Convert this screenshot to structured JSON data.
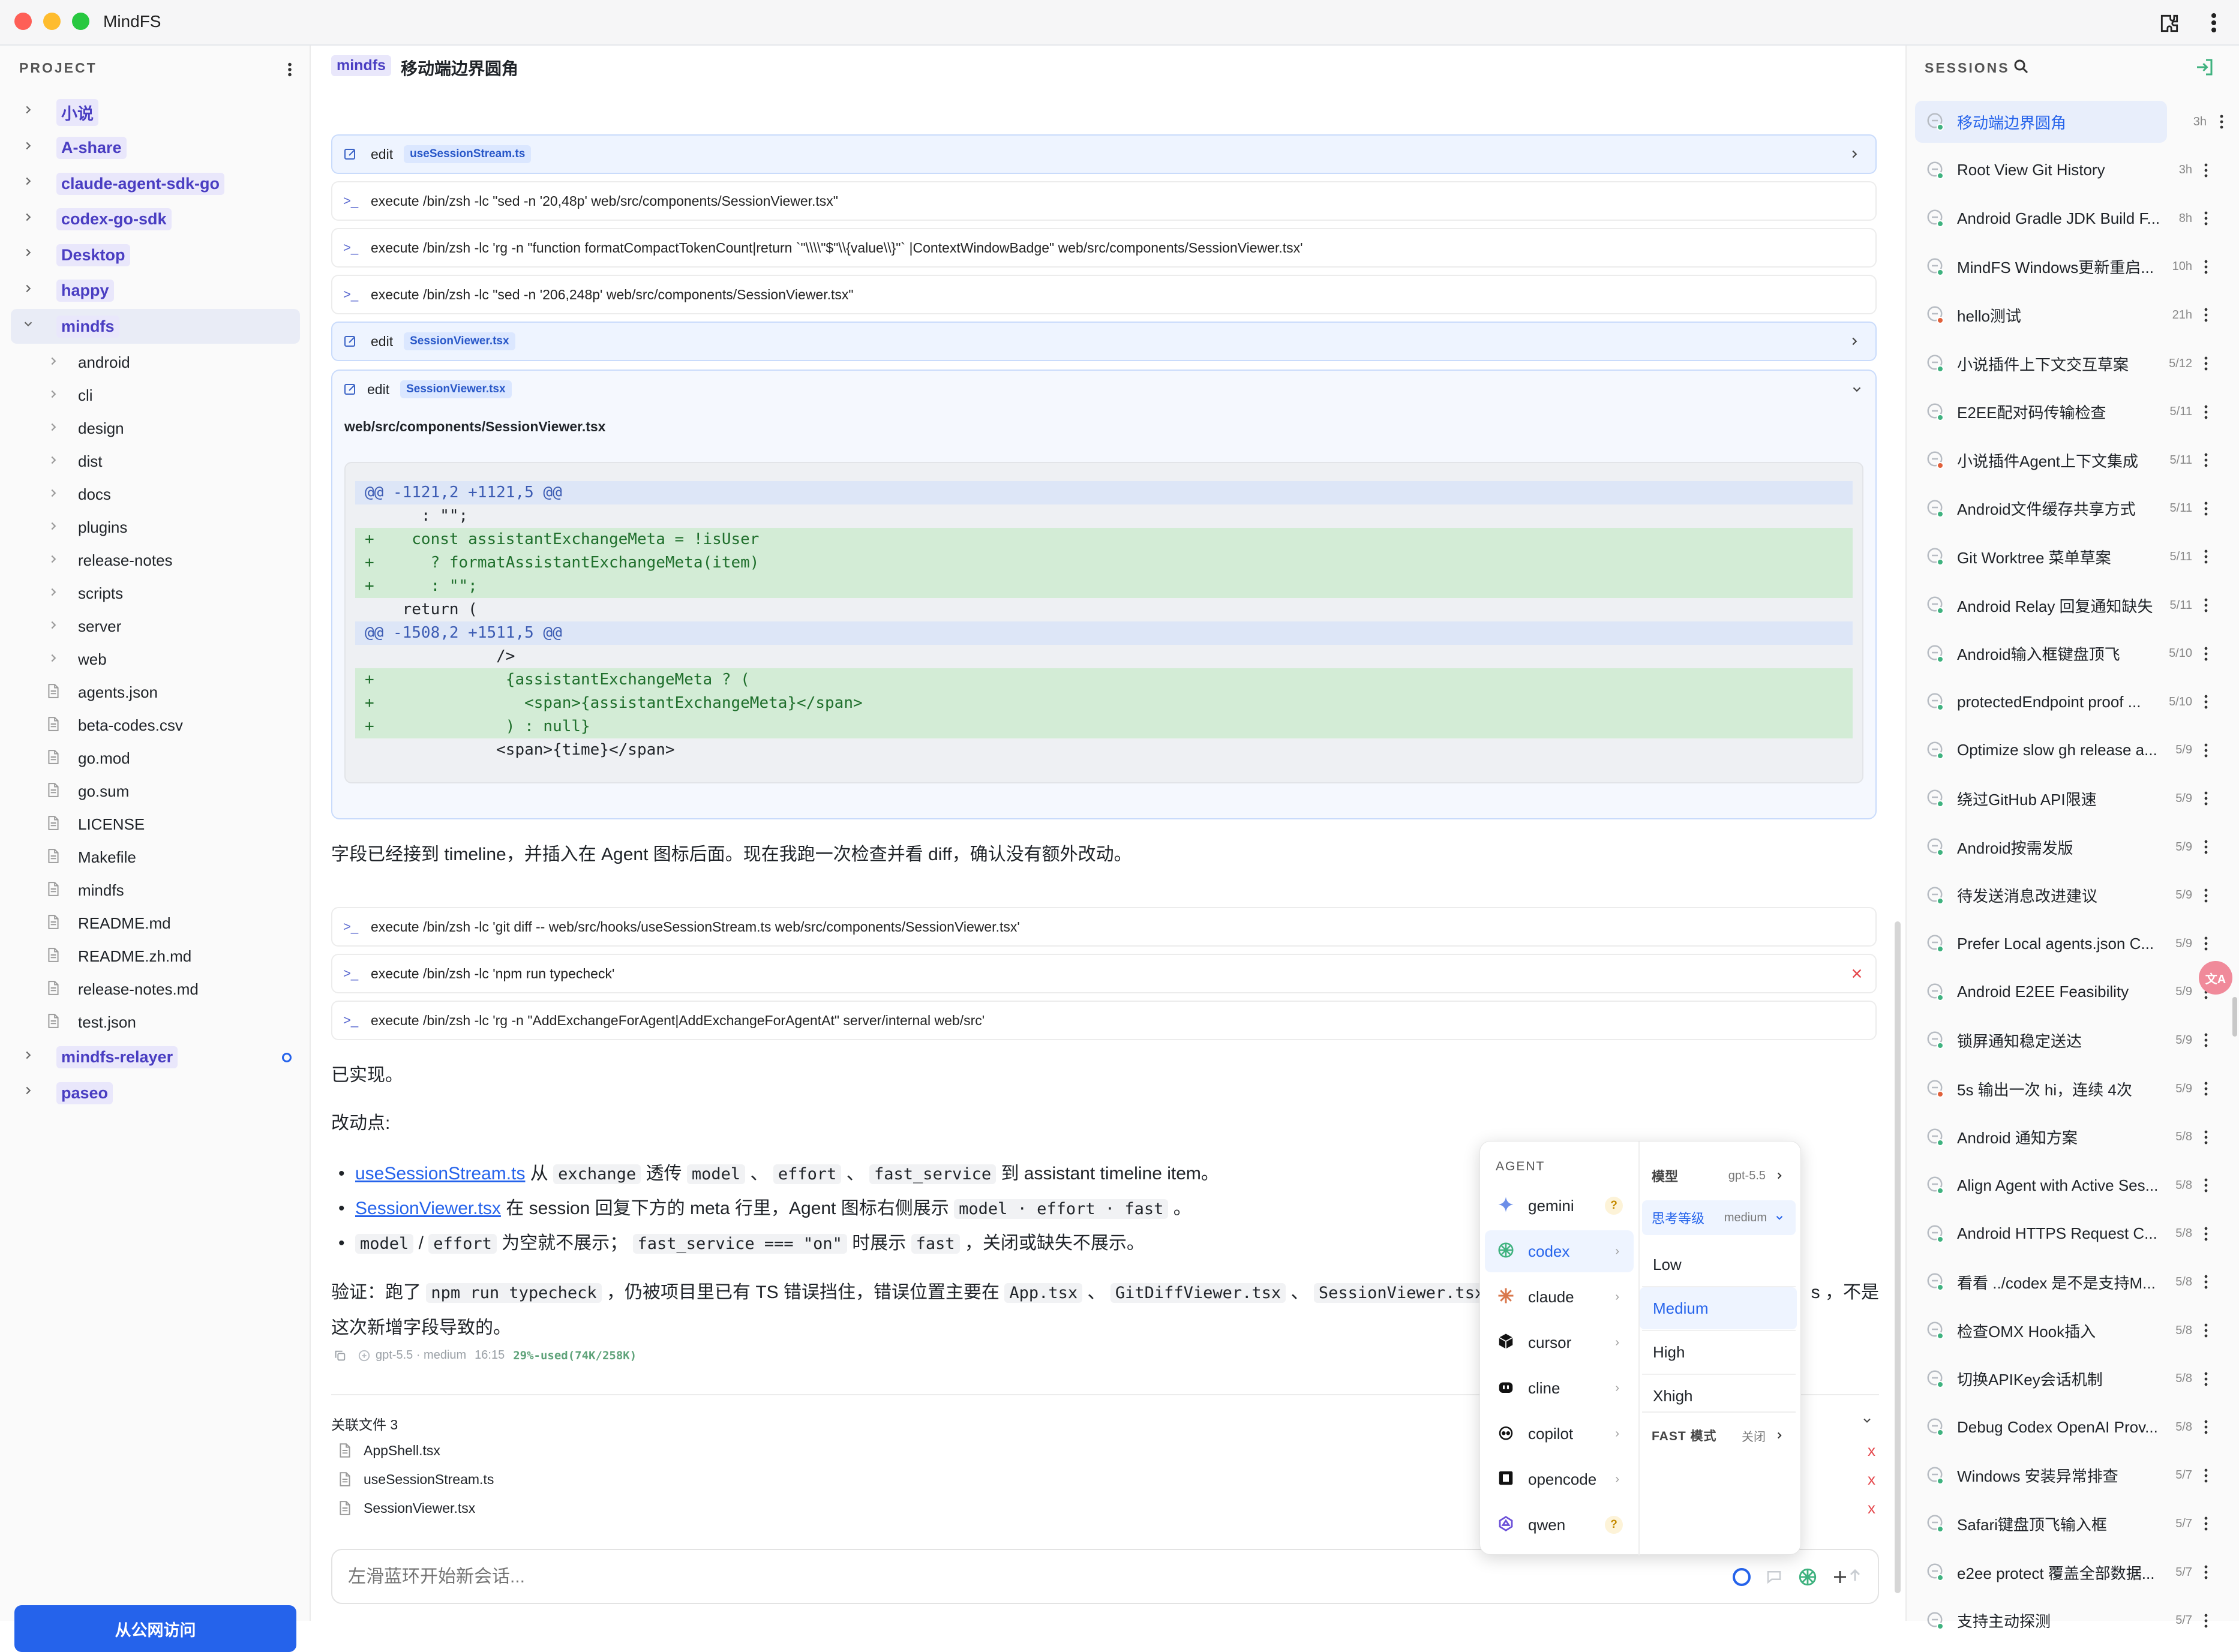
{
  "app": {
    "title": "MindFS"
  },
  "left": {
    "header": "PROJECT",
    "projects_top": [
      "小说",
      "A-share",
      "claude-agent-sdk-go",
      "codex-go-sdk",
      "Desktop",
      "happy"
    ],
    "active_project": "mindfs",
    "folders": [
      "android",
      "cli",
      "design",
      "dist",
      "docs",
      "plugins",
      "release-notes",
      "scripts",
      "server",
      "web"
    ],
    "files": [
      "agents.json",
      "beta-codes.csv",
      "go.mod",
      "go.sum",
      "LICENSE",
      "Makefile",
      "mindfs",
      "README.md",
      "README.zh.md",
      "release-notes.md",
      "test.json"
    ],
    "projects_bottom": [
      "mindfs-relayer",
      "paseo"
    ],
    "public_button": "从公网访问"
  },
  "center": {
    "header_tag": "mindfs",
    "header_title": "移动端边界圆角",
    "cmds": [
      {
        "kind": "edit",
        "label": "edit",
        "chip": "useSessionStream.ts"
      },
      {
        "kind": "exec",
        "label": "execute /bin/zsh -lc \"sed -n '20,48p' web/src/components/SessionViewer.tsx\""
      },
      {
        "kind": "exec",
        "label": "execute /bin/zsh -lc 'rg -n \"function formatCompactTokenCount|return `\"\\\\\\\\\"$\"\\\\{value\\\\}\"` |ContextWindowBadge\" web/src/components/SessionViewer.tsx'"
      },
      {
        "kind": "exec",
        "label": "execute /bin/zsh -lc \"sed -n '206,248p' web/src/components/SessionViewer.tsx\""
      },
      {
        "kind": "edit",
        "label": "edit",
        "chip": "SessionViewer.tsx"
      }
    ],
    "expanded_edit": {
      "label": "edit",
      "chip": "SessionViewer.tsx",
      "path": "web/src/components/SessionViewer.tsx"
    },
    "diff": [
      {
        "t": "hunk",
        "text": "@@ -1121,2 +1121,5 @@"
      },
      {
        "t": "ctx",
        "text": "      : \"\";"
      },
      {
        "t": "add",
        "text": "+    const assistantExchangeMeta = !isUser"
      },
      {
        "t": "add",
        "text": "+      ? formatAssistantExchangeMeta(item)"
      },
      {
        "t": "add",
        "text": "+      : \"\";"
      },
      {
        "t": "ctx",
        "text": "    return ("
      },
      {
        "t": "hunk",
        "text": "@@ -1508,2 +1511,5 @@"
      },
      {
        "t": "ctx",
        "text": "              />"
      },
      {
        "t": "add",
        "text": "+              {assistantExchangeMeta ? ("
      },
      {
        "t": "add",
        "text": "+                <span>{assistantExchangeMeta}</span>"
      },
      {
        "t": "add",
        "text": "+              ) : null}"
      },
      {
        "t": "ctx",
        "text": "              <span>{time}</span>"
      }
    ],
    "note1": "字段已经接到 timeline，并插入在 Agent 图标后面。现在我跑一次检查并看 diff，确认没有额外改动。",
    "cmds2": [
      {
        "label": "execute /bin/zsh -lc 'git diff -- web/src/hooks/useSessionStream.ts web/src/components/SessionViewer.tsx'",
        "error": false
      },
      {
        "label": "execute /bin/zsh -lc 'npm run typecheck'",
        "error": true
      },
      {
        "label": "execute /bin/zsh -lc 'rg -n \"AddExchangeForAgent|AddExchangeForAgentAt\" server/internal web/src'",
        "error": false
      }
    ],
    "done": "已实现。",
    "changes_title": "改动点:",
    "b1": {
      "link": "useSessionStream.ts",
      "t1": " 从 ",
      "c1": "exchange",
      "t2": " 透传 ",
      "c2": "model",
      "c3": "effort",
      "c4": "fast_service",
      "t3": " 到 assistant timeline item。",
      "sep": " 、 "
    },
    "b2": {
      "link": "SessionViewer.tsx",
      "t1": " 在 session 回复下方的 meta 行里，Agent 图标右侧展示 ",
      "c1": "model · effort · fast",
      "t2": " 。"
    },
    "b3": {
      "c1": "model",
      "sl": " / ",
      "c2": "effort",
      "t1": " 为空就不展示； ",
      "c3": "fast_service === \"on\"",
      "t2": " 时展示 ",
      "c4": "fast",
      "t3": " ，关闭或缺失不展示。"
    },
    "verify": {
      "t1": "验证：跑了 ",
      "c1": "npm run typecheck",
      "t2": " ，仍被项目里已有 TS 错误挡住，错误位置主要在 ",
      "c2": "App.tsx",
      "sep": " 、 ",
      "c3": "GitDiffViewer.tsx",
      "c4": "SessionViewer.tsx",
      "t3": " 既",
      "tail": "s ，不是",
      "line2": "这次新增字段导致的。"
    },
    "meta": {
      "model": "gpt-5.5 · medium",
      "time": "16:15",
      "usage": "29%-used(74K/258K)"
    },
    "related": {
      "title": "关联文件 3",
      "files": [
        "AppShell.tsx",
        "useSessionStream.ts",
        "SessionViewer.tsx"
      ],
      "remove": "x"
    },
    "input_placeholder": "左滑蓝环开始新会话..."
  },
  "popover": {
    "agent_header": "AGENT",
    "agents": [
      {
        "name": "gemini",
        "badge": "?"
      },
      {
        "name": "codex",
        "badge": "›"
      },
      {
        "name": "claude",
        "badge": "›"
      },
      {
        "name": "cursor",
        "badge": "›"
      },
      {
        "name": "cline",
        "badge": "›"
      },
      {
        "name": "copilot",
        "badge": "›"
      },
      {
        "name": "opencode",
        "badge": "›"
      },
      {
        "name": "qwen",
        "badge": "?"
      }
    ],
    "model_label": "模型",
    "model_value": "gpt-5.5",
    "effort_label": "思考等级",
    "effort_value": "medium",
    "levels": [
      "Low",
      "Medium",
      "High",
      "Xhigh"
    ],
    "fast_label": "FAST 模式",
    "fast_value": "关闭"
  },
  "right": {
    "header": "SESSIONS",
    "sessions": [
      {
        "title": "移动端边界圆角",
        "time": "3h",
        "dot": "#3fb27f"
      },
      {
        "title": "Root View Git History",
        "time": "3h",
        "dot": "#3fb27f"
      },
      {
        "title": "Android Gradle JDK Build F...",
        "time": "8h",
        "dot": "#3fb27f"
      },
      {
        "title": "MindFS Windows更新重启...",
        "time": "10h",
        "dot": "#3fb27f"
      },
      {
        "title": "hello测试",
        "time": "21h",
        "dot": "#e0603a"
      },
      {
        "title": "小说插件上下文交互草案",
        "time": "5/12",
        "dot": "#3fb27f"
      },
      {
        "title": "E2EE配对码传输检查",
        "time": "5/11",
        "dot": "#3fb27f"
      },
      {
        "title": "小说插件Agent上下文集成",
        "time": "5/11",
        "dot": "#e0603a"
      },
      {
        "title": "Android文件缓存共享方式",
        "time": "5/11",
        "dot": "#3fb27f"
      },
      {
        "title": "Git Worktree 菜单草案",
        "time": "5/11",
        "dot": "#3fb27f"
      },
      {
        "title": "Android Relay 回复通知缺失",
        "time": "5/11",
        "dot": "#3fb27f"
      },
      {
        "title": "Android输入框键盘顶飞",
        "time": "5/10",
        "dot": "#3fb27f"
      },
      {
        "title": "protectedEndpoint proof ...",
        "time": "5/10",
        "dot": "#3fb27f"
      },
      {
        "title": "Optimize slow gh release a...",
        "time": "5/9",
        "dot": "#3fb27f"
      },
      {
        "title": "绕过GitHub API限速",
        "time": "5/9",
        "dot": "#3fb27f"
      },
      {
        "title": "Android按需发版",
        "time": "5/9",
        "dot": "#3fb27f"
      },
      {
        "title": "待发送消息改进建议",
        "time": "5/9",
        "dot": "#3fb27f"
      },
      {
        "title": "Prefer Local agents.json C...",
        "time": "5/9",
        "dot": "#3fb27f"
      },
      {
        "title": "Android E2EE Feasibility",
        "time": "5/9",
        "dot": "#3fb27f"
      },
      {
        "title": "锁屏通知稳定送达",
        "time": "5/9",
        "dot": "#3fb27f"
      },
      {
        "title": "5s 输出一次 hi，连续 4次",
        "time": "5/9",
        "dot": "#e0603a"
      },
      {
        "title": "Android 通知方案",
        "time": "5/8",
        "dot": "#3fb27f"
      },
      {
        "title": "Align Agent with Active Ses...",
        "time": "5/8",
        "dot": "#3fb27f"
      },
      {
        "title": "Android HTTPS Request C...",
        "time": "5/8",
        "dot": "#3fb27f"
      },
      {
        "title": "看看 ../codex 是不是支持M...",
        "time": "5/8",
        "dot": "#3fb27f"
      },
      {
        "title": "检查OMX Hook插入",
        "time": "5/8",
        "dot": "#3fb27f"
      },
      {
        "title": "切换APIKey会话机制",
        "time": "5/8",
        "dot": "#3fb27f"
      },
      {
        "title": "Debug Codex OpenAI Prov...",
        "time": "5/8",
        "dot": "#3fb27f"
      },
      {
        "title": "Windows 安装异常排查",
        "time": "5/7",
        "dot": "#3fb27f"
      },
      {
        "title": "Safari键盘顶飞输入框",
        "time": "5/7",
        "dot": "#3fb27f"
      },
      {
        "title": "e2ee protect 覆盖全部数据...",
        "time": "5/7",
        "dot": "#3fb27f"
      },
      {
        "title": "支持主动探测",
        "time": "5/7",
        "dot": "#3fb27f"
      }
    ],
    "translate_badge": "文A"
  }
}
